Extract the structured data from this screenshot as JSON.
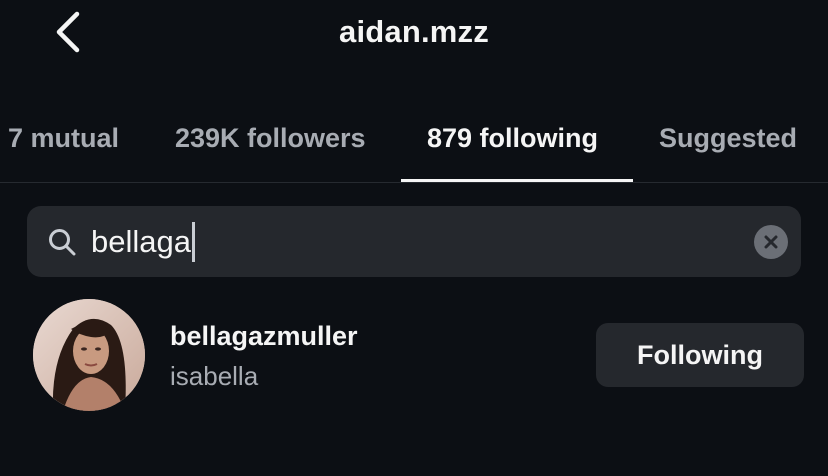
{
  "header": {
    "title": "aidan.mzz",
    "back_icon": "chevron-left-icon"
  },
  "tabs": [
    {
      "label": "7 mutual",
      "active": false
    },
    {
      "label": "239K followers",
      "active": false
    },
    {
      "label": "879 following",
      "active": true
    },
    {
      "label": "Suggested",
      "active": false
    }
  ],
  "search": {
    "value": "bellaga",
    "icon": "search-icon",
    "clear_icon": "clear-icon"
  },
  "results": [
    {
      "username": "bellagazmuller",
      "full_name": "isabella",
      "button_label": "Following"
    }
  ],
  "colors": {
    "background": "#0c0f14",
    "surface": "#25282d",
    "text_primary": "#f5f5f5",
    "text_secondary": "#a8acb3"
  }
}
